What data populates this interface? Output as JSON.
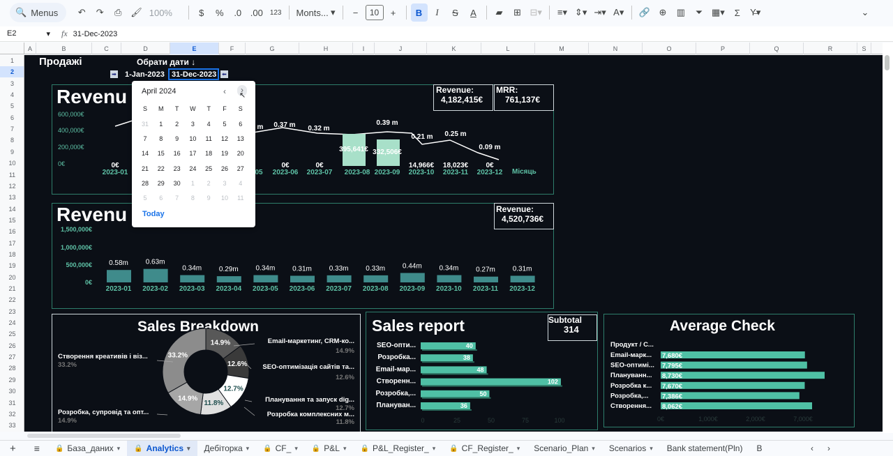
{
  "toolbar": {
    "menus": "Menus",
    "zoom": "100%",
    "currency": "$",
    "percent": "%",
    "dec_less": ".0",
    "dec_more": ".00",
    "num_fmt": "123",
    "font": "Monts...",
    "font_size": "10",
    "bold": "B",
    "italic": "I",
    "strike": "S",
    "textcolor": "A",
    "sum": "Σ"
  },
  "formula": {
    "cell": "E2",
    "value": "31-Dec-2023"
  },
  "columns": [
    "A",
    "B",
    "C",
    "D",
    "E",
    "F",
    "G",
    "H",
    "I",
    "J",
    "K",
    "L",
    "M",
    "N",
    "O",
    "P",
    "Q",
    "R",
    "S"
  ],
  "rows": [
    "1",
    "2",
    "3",
    "4",
    "5",
    "6",
    "7",
    "8",
    "9",
    "10",
    "11",
    "12",
    "13",
    "14",
    "15",
    "16",
    "17",
    "18",
    "19",
    "20",
    "21",
    "22",
    "23",
    "24",
    "25",
    "26",
    "27",
    "28",
    "29",
    "30",
    "31",
    "32",
    "33"
  ],
  "sheet": {
    "title": "Продажі",
    "choose_dates": "Обрати дати ↓",
    "date_from": "1-Jan-2023",
    "date_to": "31-Dec-2023",
    "revenue_title": "Revenu",
    "revenue_label": "Revenue:",
    "revenue_value": "4,182,415€",
    "mrr_label": "MRR:",
    "mrr_value": "761,137€",
    "revenue2_title": "Revenu",
    "revenue2_label": "Revenue:",
    "revenue2_value": "4,520,736€",
    "month_label": "Місяць",
    "sales_breakdown": "Sales Breakdown",
    "sales_report": "Sales report",
    "subtotal_label": "Subtotal",
    "subtotal_value": "314",
    "avg_check": "Average Check"
  },
  "chart1": {
    "yticks": [
      "600,000€",
      "400,000€",
      "200,000€",
      "0€"
    ],
    "months": [
      "2023-01",
      "05",
      "2023-06",
      "2023-07",
      "2023-08",
      "2023-09",
      "2023-10",
      "2023-11",
      "2023-12"
    ],
    "line_labels": [
      "m",
      "0.37 m",
      "0.32 m",
      "0.39 m",
      "0.21 m",
      "0.25 m",
      "0.09 m"
    ],
    "bar_labels": [
      "0€",
      "0€",
      "0€",
      "395,641€",
      "332,506€",
      "14,966€",
      "18,023€",
      "0€"
    ]
  },
  "chart_data": [
    {
      "type": "bar",
      "categories": [
        "2023-01",
        "2023-02",
        "2023-03",
        "2023-04",
        "2023-05",
        "2023-06",
        "2023-07",
        "2023-08",
        "2023-09",
        "2023-10",
        "2023-11",
        "2023-12"
      ],
      "series": [
        {
          "values": [
            0.58,
            0.63,
            0.34,
            0.29,
            0.34,
            0.31,
            0.33,
            0.33,
            0.44,
            0.34,
            0.27,
            0.31
          ]
        }
      ],
      "labels": [
        "0.58m",
        "0.63m",
        "0.34m",
        "0.29m",
        "0.34m",
        "0.31m",
        "0.33m",
        "0.33m",
        "0.44m",
        "0.34m",
        "0.27m",
        "0.31m"
      ],
      "yticks": [
        "1,500,000€",
        "1,000,000€",
        "500,000€",
        "0€"
      ],
      "ylim": [
        0,
        1.5
      ]
    },
    {
      "type": "bar",
      "categories": [
        "SEO-опти...",
        "Розробка...",
        "Email-мар...",
        "Створенн...",
        "Розробка,...",
        "Плануван..."
      ],
      "values": [
        40,
        38,
        48,
        102,
        50,
        36
      ],
      "xticks": [
        "0",
        "25",
        "50",
        "75",
        "100"
      ]
    },
    {
      "type": "bar",
      "categories": [
        "Email-марк...",
        "SEO-оптимі...",
        "Плануванн...",
        "Розробка к...",
        "Розробка,...",
        "Створення..."
      ],
      "values": [
        7680,
        7795,
        8730,
        7670,
        7386,
        8062
      ],
      "labels": [
        "7,680€",
        "7,795€",
        "8,730€",
        "7,670€",
        "7,386€",
        "8,062€"
      ],
      "header": "Продукт / С...",
      "xticks": [
        "0€",
        "1,000€",
        "2,000€",
        "7,000€"
      ]
    },
    {
      "type": "pie",
      "slices": [
        {
          "label": "Email-маркетинг, CRM-ко...",
          "value": 14.9
        },
        {
          "label": "SEO-оптимізація сайтів та...",
          "value": 12.6
        },
        {
          "label": "Планування та запуск dig...",
          "value": 12.7
        },
        {
          "label": "Розробка комплексних м...",
          "value": 11.8
        },
        {
          "label": "Розробка, супровід та опт...",
          "value": 14.9
        },
        {
          "label": "Створення креативів і віз...",
          "value": 33.2
        }
      ],
      "pcts": [
        "14.9%",
        "12.6%",
        "12.7%",
        "11.8%",
        "14.9%",
        "33.2%"
      ]
    }
  ],
  "calendar": {
    "month": "April 2024",
    "weekdays": [
      "S",
      "M",
      "T",
      "W",
      "T",
      "F",
      "S"
    ],
    "today": "Today",
    "weeks": [
      [
        "31",
        "1",
        "2",
        "3",
        "4",
        "5",
        "6"
      ],
      [
        "7",
        "8",
        "9",
        "10",
        "11",
        "12",
        "13"
      ],
      [
        "14",
        "15",
        "16",
        "17",
        "18",
        "19",
        "20"
      ],
      [
        "21",
        "22",
        "23",
        "24",
        "25",
        "26",
        "27"
      ],
      [
        "28",
        "29",
        "30",
        "1",
        "2",
        "3",
        "4"
      ],
      [
        "5",
        "6",
        "7",
        "8",
        "9",
        "10",
        "11"
      ]
    ]
  },
  "tabs": [
    "База_даних",
    "Analytics",
    "Дебіторка",
    "CF_",
    "P&L",
    "P&L_Register_",
    "CF_Register_",
    "Scenario_Plan",
    "Scenarios",
    "Bank statement(Pln)",
    "B"
  ]
}
